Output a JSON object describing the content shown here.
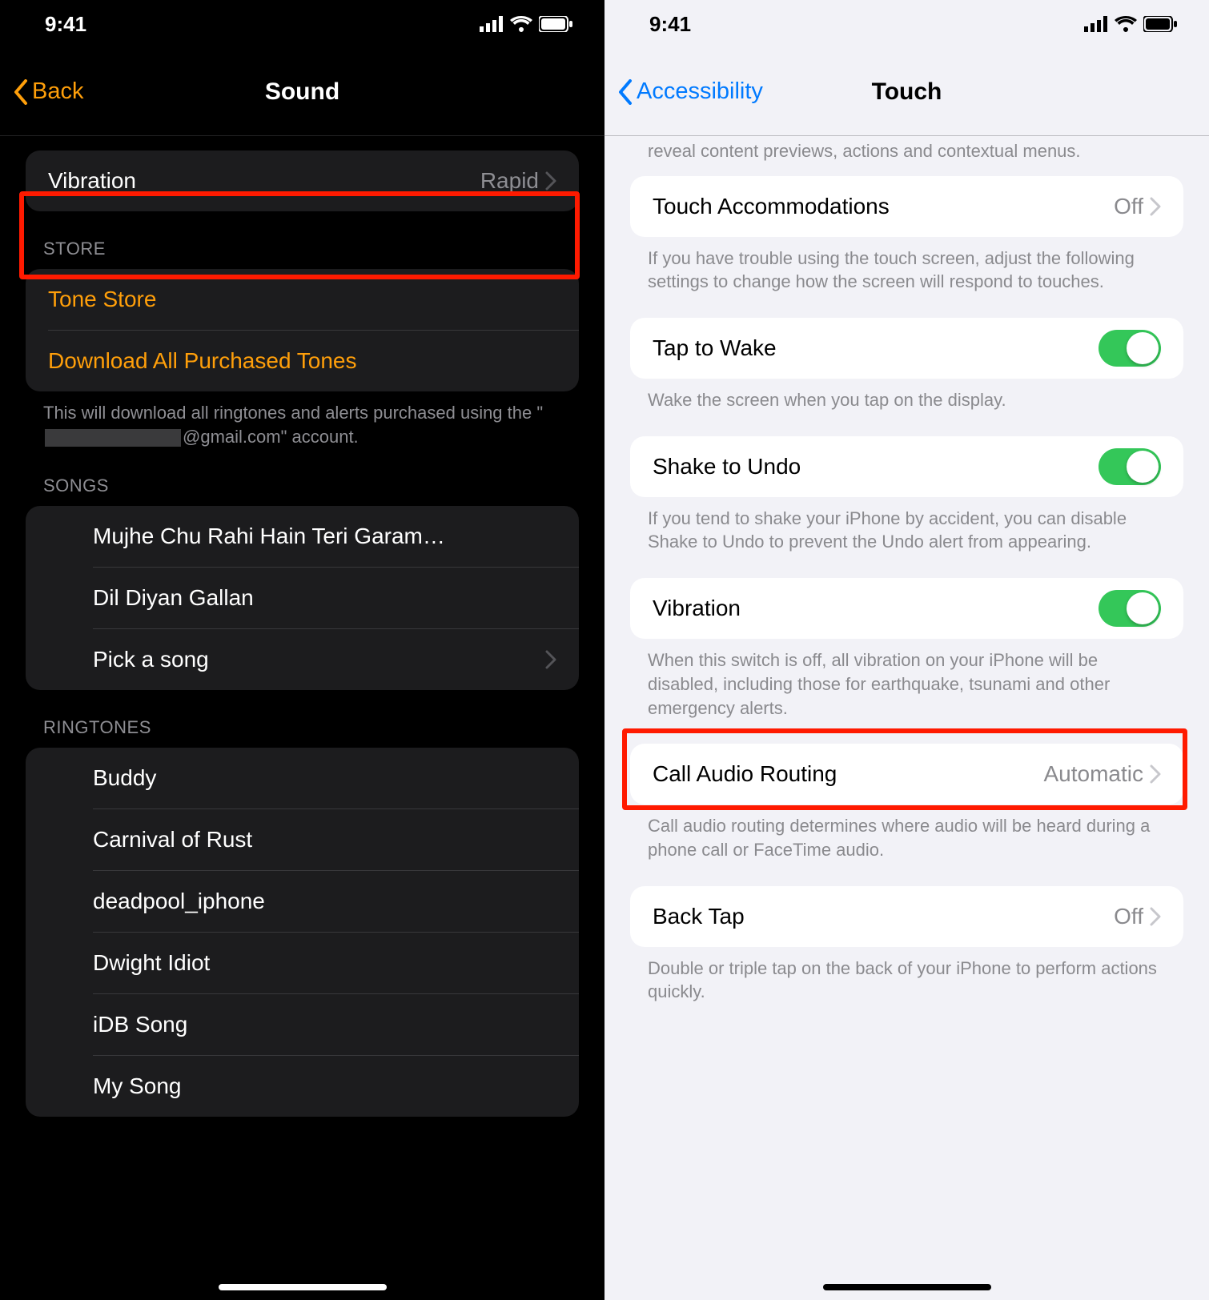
{
  "status": {
    "time": "9:41"
  },
  "left": {
    "back_label": "Back",
    "title": "Sound",
    "vibration": {
      "label": "Vibration",
      "value": "Rapid"
    },
    "store_header": "STORE",
    "store_items": [
      "Tone Store",
      "Download All Purchased Tones"
    ],
    "store_footer_prefix": "This will download all ringtones and alerts purchased using the \"",
    "store_footer_suffix": "@gmail.com\" account.",
    "songs_header": "SONGS",
    "songs": [
      "Mujhe Chu Rahi Hain Teri Garam…",
      "Dil Diyan Gallan"
    ],
    "pick_song": "Pick a song",
    "ringtones_header": "RINGTONES",
    "ringtones": [
      "Buddy",
      "Carnival of Rust",
      "deadpool_iphone",
      "Dwight Idiot",
      "iDB Song",
      "My Song"
    ]
  },
  "right": {
    "back_label": "Accessibility",
    "title": "Touch",
    "peek_footer": "reveal content previews, actions and contextual menus.",
    "rows": {
      "touch_accom": {
        "label": "Touch Accommodations",
        "value": "Off"
      },
      "touch_accom_footer": "If you have trouble using the touch screen, adjust the following settings to change how the screen will respond to touches.",
      "tap_wake": {
        "label": "Tap to Wake",
        "on": true
      },
      "tap_wake_footer": "Wake the screen when you tap on the display.",
      "shake": {
        "label": "Shake to Undo",
        "on": true
      },
      "shake_footer": "If you tend to shake your iPhone by accident, you can disable Shake to Undo to prevent the Undo alert from appearing.",
      "vibration": {
        "label": "Vibration",
        "on": true
      },
      "vibration_footer": "When this switch is off, all vibration on your iPhone will be disabled, including those for earthquake, tsunami and other emergency alerts.",
      "call_audio": {
        "label": "Call Audio Routing",
        "value": "Automatic"
      },
      "call_audio_footer": "Call audio routing determines where audio will be heard during a phone call or FaceTime audio.",
      "back_tap": {
        "label": "Back Tap",
        "value": "Off"
      },
      "back_tap_footer": "Double or triple tap on the back of your iPhone to perform actions quickly."
    }
  }
}
